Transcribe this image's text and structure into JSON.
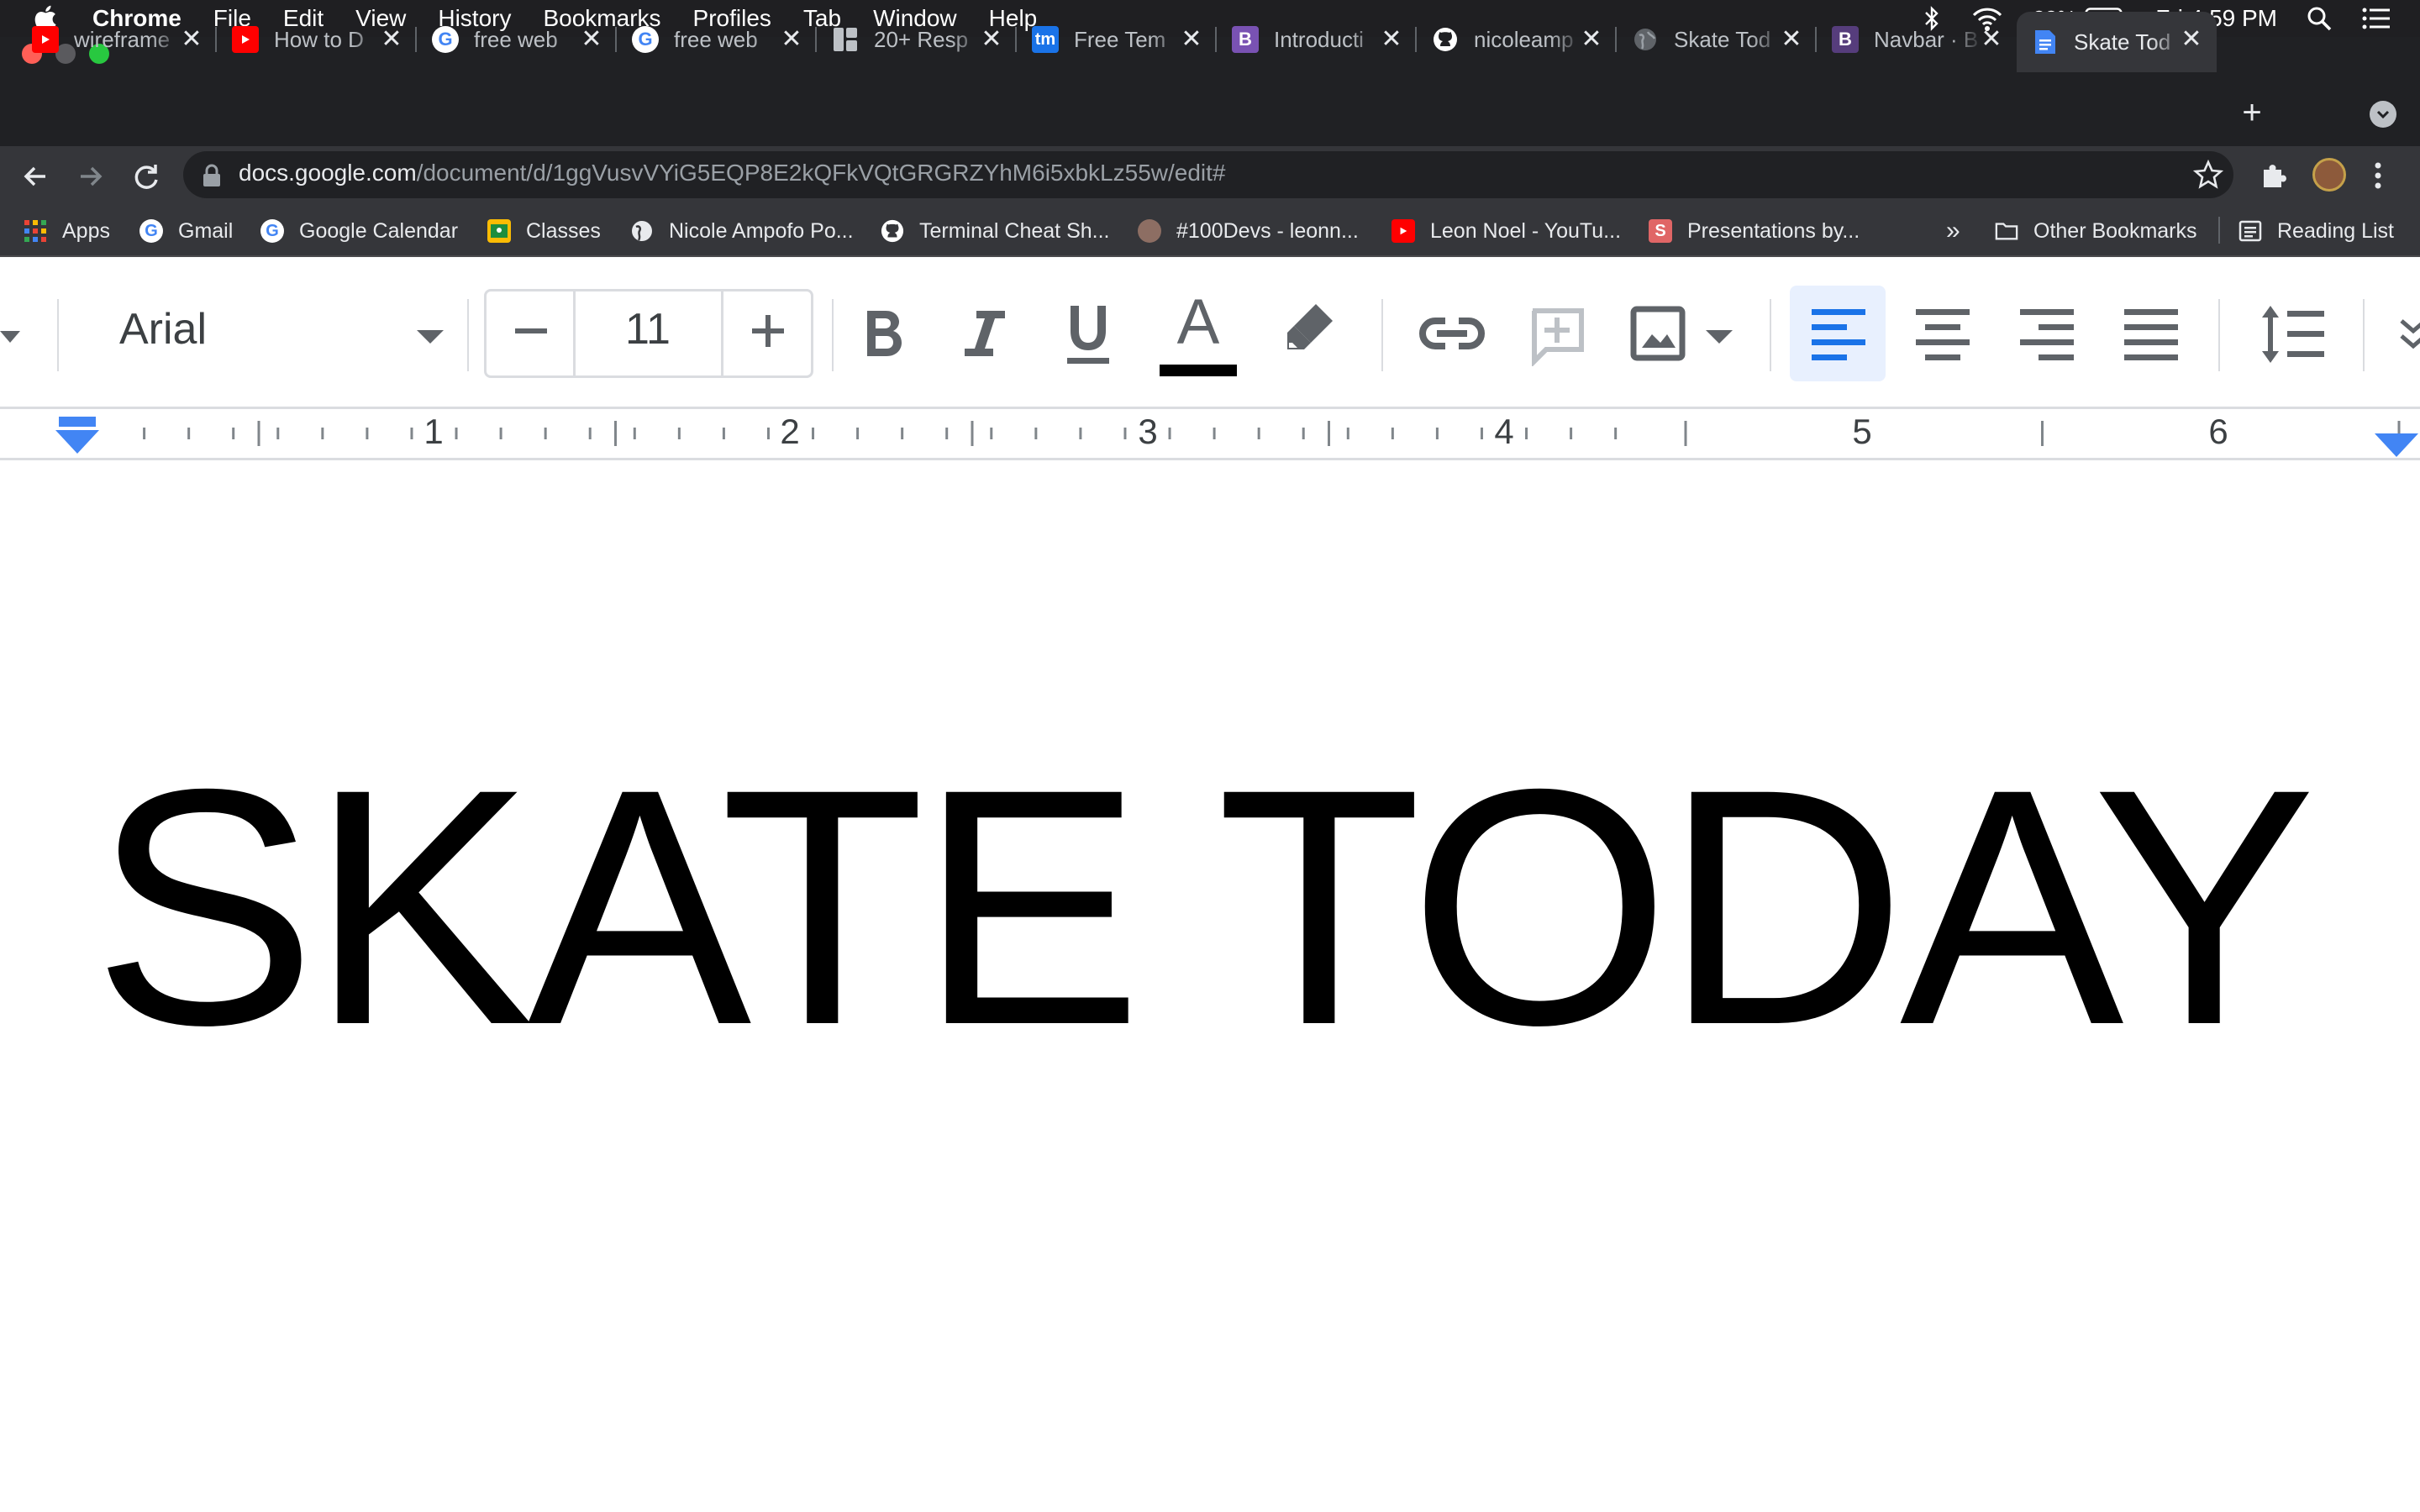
{
  "menubar": {
    "app": "Chrome",
    "items": [
      "File",
      "Edit",
      "View",
      "History",
      "Bookmarks",
      "Profiles",
      "Tab",
      "Window",
      "Help"
    ],
    "battery": "23%",
    "clock": "Fri 4:59 PM"
  },
  "tabs": [
    {
      "title": "wireframe",
      "favicon": "youtube-icon",
      "color": "#ff0000"
    },
    {
      "title": "How to D",
      "favicon": "youtube-icon",
      "color": "#ff0000"
    },
    {
      "title": "free web",
      "favicon": "google-icon",
      "color": "#ffffff"
    },
    {
      "title": "free web",
      "favicon": "google-icon",
      "color": "#ffffff"
    },
    {
      "title": "20+ Resp",
      "favicon": "grid-icon",
      "color": "#bdc1c6"
    },
    {
      "title": "Free Tem",
      "favicon": "tm-icon",
      "color": "#1a73e8"
    },
    {
      "title": "Introducti",
      "favicon": "bootstrap-icon",
      "color": "#7952b3"
    },
    {
      "title": "nicoleamp",
      "favicon": "github-icon",
      "color": "#ffffff"
    },
    {
      "title": "Skate Tod",
      "favicon": "globe-icon",
      "color": "#5f6368"
    },
    {
      "title": "Navbar · B",
      "favicon": "bootstrap-icon",
      "color": "#563d7c"
    },
    {
      "title": "Skate Tod",
      "favicon": "docs-icon",
      "color": "#4285f4",
      "active": true
    }
  ],
  "address": {
    "host": "docs.google.com",
    "path": "/document/d/1ggVusvVYiG5EQP8E2kQFkVQtGRGRZYhM6i5xbkLz55w/edit#"
  },
  "bookmarks": [
    {
      "label": "Apps",
      "icon": "apps-grid-icon",
      "color": "#ea4335"
    },
    {
      "label": "Gmail",
      "icon": "google-icon",
      "color": "#ffffff"
    },
    {
      "label": "Google Calendar",
      "icon": "google-icon",
      "color": "#ffffff"
    },
    {
      "label": "Classes",
      "icon": "classroom-icon",
      "color": "#fbbc04"
    },
    {
      "label": "Nicole Ampofo Po...",
      "icon": "globe-icon",
      "color": "#ffffff"
    },
    {
      "label": "Terminal Cheat Sh...",
      "icon": "github-icon",
      "color": "#ffffff"
    },
    {
      "label": "#100Devs - leonn...",
      "icon": "avatar-icon",
      "color": "#8d6e63"
    },
    {
      "label": "Leon Noel - YouTu...",
      "icon": "youtube-icon",
      "color": "#ff0000"
    },
    {
      "label": "Presentations by...",
      "icon": "slides-s-icon",
      "color": "#e06666"
    }
  ],
  "bookmarks_overflow": "»",
  "other_bookmarks": "Other Bookmarks",
  "reading_list": "Reading List",
  "docs_toolbar": {
    "font": "Arial",
    "font_size": "11",
    "bold": "B",
    "text_color_letter": "A"
  },
  "ruler": [
    "1",
    "2",
    "3",
    "4",
    "5",
    "6"
  ],
  "document": {
    "text": "SKATE TODAY"
  }
}
